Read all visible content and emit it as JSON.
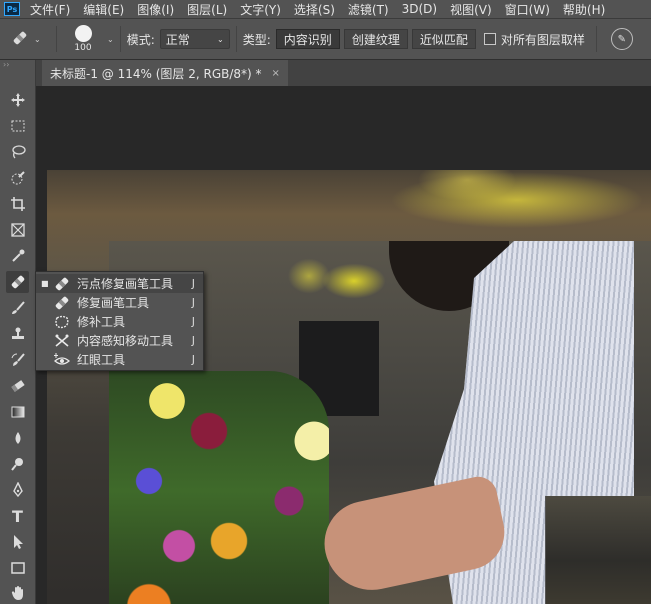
{
  "app": {
    "logo": "Ps"
  },
  "menu": [
    "文件(F)",
    "编辑(E)",
    "图像(I)",
    "图层(L)",
    "文字(Y)",
    "选择(S)",
    "滤镜(T)",
    "3D(D)",
    "视图(V)",
    "窗口(W)",
    "帮助(H)"
  ],
  "options": {
    "tool_icon": "spot-healing-brush-icon",
    "brush_size": "100",
    "mode_label": "模式:",
    "mode_value": "正常",
    "type_label": "类型:",
    "type_buttons": [
      "内容识别",
      "创建纹理",
      "近似匹配"
    ],
    "sample_all_layers": "对所有图层取样",
    "sample_all_layers_checked": false
  },
  "document_tab": {
    "title": "未标题-1 @ 114% (图层 2, RGB/8*) *",
    "close": "×"
  },
  "toolbar": {
    "grip": "››",
    "tools": [
      "move-icon",
      "marquee-icon",
      "lasso-icon",
      "quick-selection-icon",
      "crop-icon",
      "frame-icon",
      "eyedropper-icon",
      "spot-healing-brush-icon",
      "brush-icon",
      "clone-stamp-icon",
      "history-brush-icon",
      "eraser-icon",
      "gradient-icon",
      "blur-icon",
      "dodge-icon",
      "pen-icon",
      "type-icon",
      "path-selection-icon",
      "rectangle-icon",
      "hand-icon"
    ],
    "type_tool_glyph": "T"
  },
  "flyout": {
    "items": [
      {
        "label": "污点修复画笔工具",
        "shortcut": "J",
        "icon": "spot-healing-brush-icon",
        "current": true
      },
      {
        "label": "修复画笔工具",
        "shortcut": "J",
        "icon": "healing-brush-icon",
        "current": false
      },
      {
        "label": "修补工具",
        "shortcut": "J",
        "icon": "patch-icon",
        "current": false
      },
      {
        "label": "内容感知移动工具",
        "shortcut": "J",
        "icon": "content-aware-move-icon",
        "current": false
      },
      {
        "label": "红眼工具",
        "shortcut": "J",
        "icon": "red-eye-icon",
        "current": false
      }
    ],
    "bullet": "■"
  },
  "colors": {
    "panel": "#535353",
    "canvas_bg": "#282828",
    "accent": "#31a8ff"
  }
}
